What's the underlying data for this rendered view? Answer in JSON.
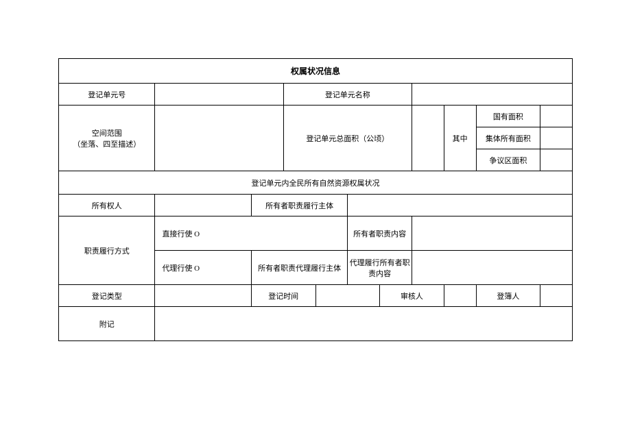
{
  "title": "权属状况信息",
  "labels": {
    "unit_no": "登记单元号",
    "unit_name": "登记单元名称",
    "spatial_scope_line1": "空间范围",
    "spatial_scope_line2": "（坐落、四至描述）",
    "unit_total_area": "登记单元总面积（公顷）",
    "among": "其中",
    "state_owned_area": "国有面积",
    "collective_area": "集体所有面积",
    "disputed_area": "争议区面积",
    "sub_header": "登记单元内全民所有自然资源权属状况",
    "owner": "所有权人",
    "owner_duty_subject": "所有者职责履行主体",
    "duty_method": "职责履行方式",
    "direct_exercise": "直接行使 O",
    "owner_duty_content": "所有者职责内容",
    "proxy_exercise": "代理行使 O",
    "owner_duty_proxy_subject": "所有者职责代理履行主体",
    "proxy_duty_content_line1": "代理履行所有者职",
    "proxy_duty_content_line2": "责内容",
    "reg_type": "登记类型",
    "reg_time": "登记时间",
    "reviewer": "审核人",
    "registrar": "登簿人",
    "notes": "附记"
  },
  "values": {
    "unit_no": "",
    "unit_name": "",
    "spatial_scope": "",
    "unit_total_area": "",
    "state_owned_area": "",
    "collective_area": "",
    "disputed_area": "",
    "owner": "",
    "owner_duty_subject": "",
    "owner_duty_content": "",
    "owner_duty_proxy_subject": "",
    "proxy_duty_content": "",
    "reg_type": "",
    "reg_time": "",
    "reviewer": "",
    "registrar": "",
    "notes": ""
  }
}
